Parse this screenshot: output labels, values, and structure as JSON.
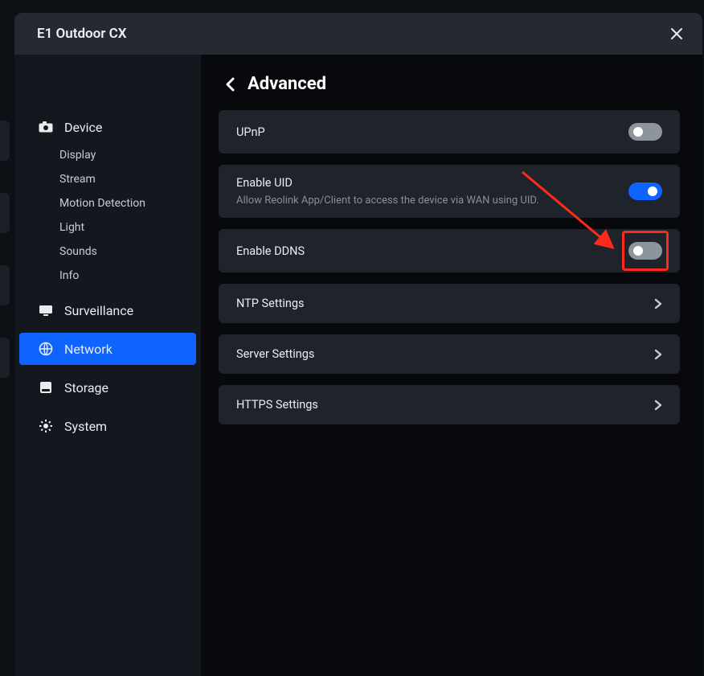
{
  "window": {
    "title": "E1 Outdoor CX"
  },
  "page": {
    "title": "Advanced"
  },
  "sidebar": {
    "groups": [
      {
        "label": "Device",
        "icon": "camera-icon",
        "items": [
          {
            "label": "Display"
          },
          {
            "label": "Stream"
          },
          {
            "label": "Motion Detection"
          },
          {
            "label": "Light"
          },
          {
            "label": "Sounds"
          },
          {
            "label": "Info"
          }
        ]
      },
      {
        "label": "Surveillance",
        "icon": "monitor-icon",
        "items": []
      },
      {
        "label": "Network",
        "icon": "globe-icon",
        "items": [],
        "active": true
      },
      {
        "label": "Storage",
        "icon": "disk-icon",
        "items": []
      },
      {
        "label": "System",
        "icon": "gear-icon",
        "items": []
      }
    ]
  },
  "settings": {
    "upnp": {
      "title": "UPnP",
      "enabled": false
    },
    "uid": {
      "title": "Enable UID",
      "sub": "Allow Reolink App/Client to access the device via WAN using UID.",
      "enabled": true
    },
    "ddns": {
      "title": "Enable DDNS",
      "enabled": false,
      "highlighted": true
    },
    "ntp": {
      "title": "NTP Settings"
    },
    "server": {
      "title": "Server Settings"
    },
    "https": {
      "title": "HTTPS Settings"
    }
  }
}
